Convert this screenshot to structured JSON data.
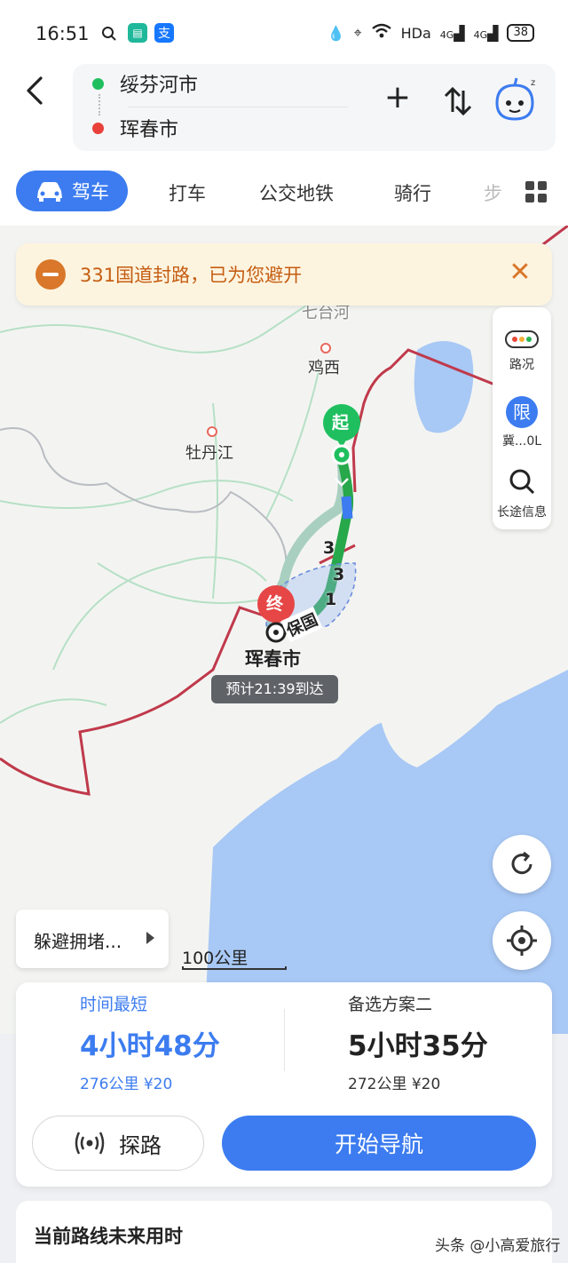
{
  "status_bar": {
    "time": "16:51",
    "network": "HDa",
    "signal1": "4G",
    "signal2": "4G",
    "battery": "38"
  },
  "route": {
    "start": "绥芬河市",
    "end": "珲春市"
  },
  "modes": [
    {
      "label": "驾车",
      "active": true
    },
    {
      "label": "打车"
    },
    {
      "label": "公交地铁"
    },
    {
      "label": "骑行"
    },
    {
      "label": "步"
    }
  ],
  "alert": {
    "text": "331国道封路，已为您避开"
  },
  "side_panel": {
    "traffic_label": "路况",
    "limit_badge": "限",
    "limit_label": "冀...0L",
    "longtrip_label": "长途信息"
  },
  "map": {
    "cities": {
      "qitaihe": "七台河",
      "jixi": "鸡西",
      "mudanjiang": "牡丹江",
      "dest": "珲春市"
    },
    "start_marker": "起",
    "end_marker": "终",
    "eta": "预计21:39到达",
    "road_numbers": [
      "3",
      "3",
      "1"
    ],
    "road_tag": "保国",
    "scale": "100公里",
    "route_color": "#27a84a",
    "water_color": "#a8c8f5",
    "border_color": "#c0394b"
  },
  "avoid_button": "躲避拥堵...",
  "options": [
    {
      "tag": "时间最短",
      "time": "4小时48分",
      "distance": "276公里",
      "toll": "¥20"
    },
    {
      "tag": "备选方案二",
      "time": "5小时35分",
      "distance": "272公里",
      "toll": "¥20"
    }
  ],
  "buttons": {
    "probe": "探路",
    "navigate": "开始导航"
  },
  "future_title": "当前路线未来用时",
  "watermark": "头条 @小高爱旅行",
  "colors": {
    "accent": "#3c7cf0",
    "alert_bg": "#fdf4df",
    "alert_text": "#c55d12"
  }
}
